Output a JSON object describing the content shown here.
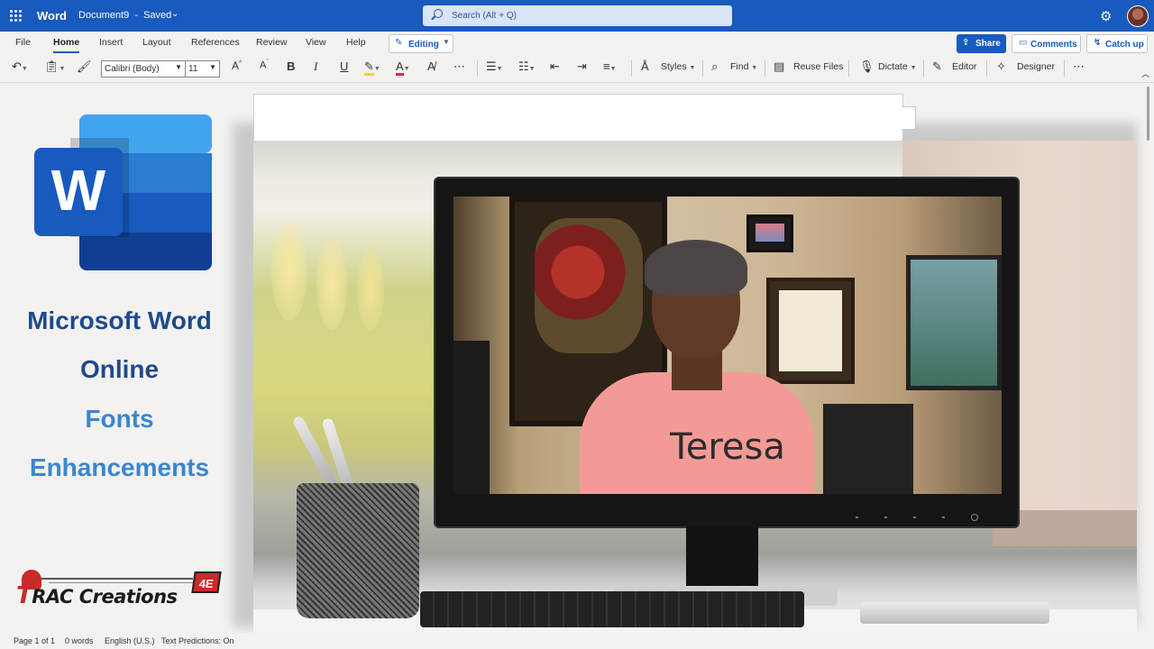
{
  "app": {
    "name": "Word",
    "document": "Document9",
    "separator": "-",
    "save_state": "Saved",
    "chevron_icon": "chevron-down-icon"
  },
  "search": {
    "placeholder": "Search (Alt + Q)",
    "icon": "search-icon"
  },
  "header_right": {
    "settings_icon": "gear-icon",
    "avatar": "user-avatar"
  },
  "tabs": [
    {
      "label": "File",
      "active": false
    },
    {
      "label": "Home",
      "active": true
    },
    {
      "label": "Insert",
      "active": false
    },
    {
      "label": "Layout",
      "active": false
    },
    {
      "label": "References",
      "active": false
    },
    {
      "label": "Review",
      "active": false
    },
    {
      "label": "View",
      "active": false
    },
    {
      "label": "Help",
      "active": false
    }
  ],
  "mode_button": {
    "label": "Editing",
    "icon": "pencil-icon"
  },
  "actions": {
    "share": "Share",
    "comments": "Comments",
    "catch_up": "Catch up"
  },
  "toolbar": {
    "font_name": "Calibri (Body)",
    "font_size": "11",
    "styles": "Styles",
    "find": "Find",
    "reuse_files": "Reuse Files",
    "dictate": "Dictate",
    "editor": "Editor",
    "designer": "Designer",
    "bold": "B",
    "italic": "I",
    "underline": "U"
  },
  "promo": {
    "line1": "Microsoft Word",
    "line2": "Online",
    "line3": "Fonts",
    "line4": "Enhancements",
    "logo_letter": "W"
  },
  "brand": {
    "text_first": "T",
    "text_rest": "RAC Creations",
    "badge": "4E"
  },
  "video": {
    "presenter_name": "Teresa"
  },
  "status": {
    "page": "Page 1 of 1",
    "words": "0 words",
    "language": "English (U.S.)",
    "predictions": "Text Predictions: On"
  },
  "colors": {
    "titlebar": "#185abd",
    "promo_dark": "#1d4a8f",
    "promo_light": "#3a86d0",
    "brand_red": "#c92a2a"
  }
}
